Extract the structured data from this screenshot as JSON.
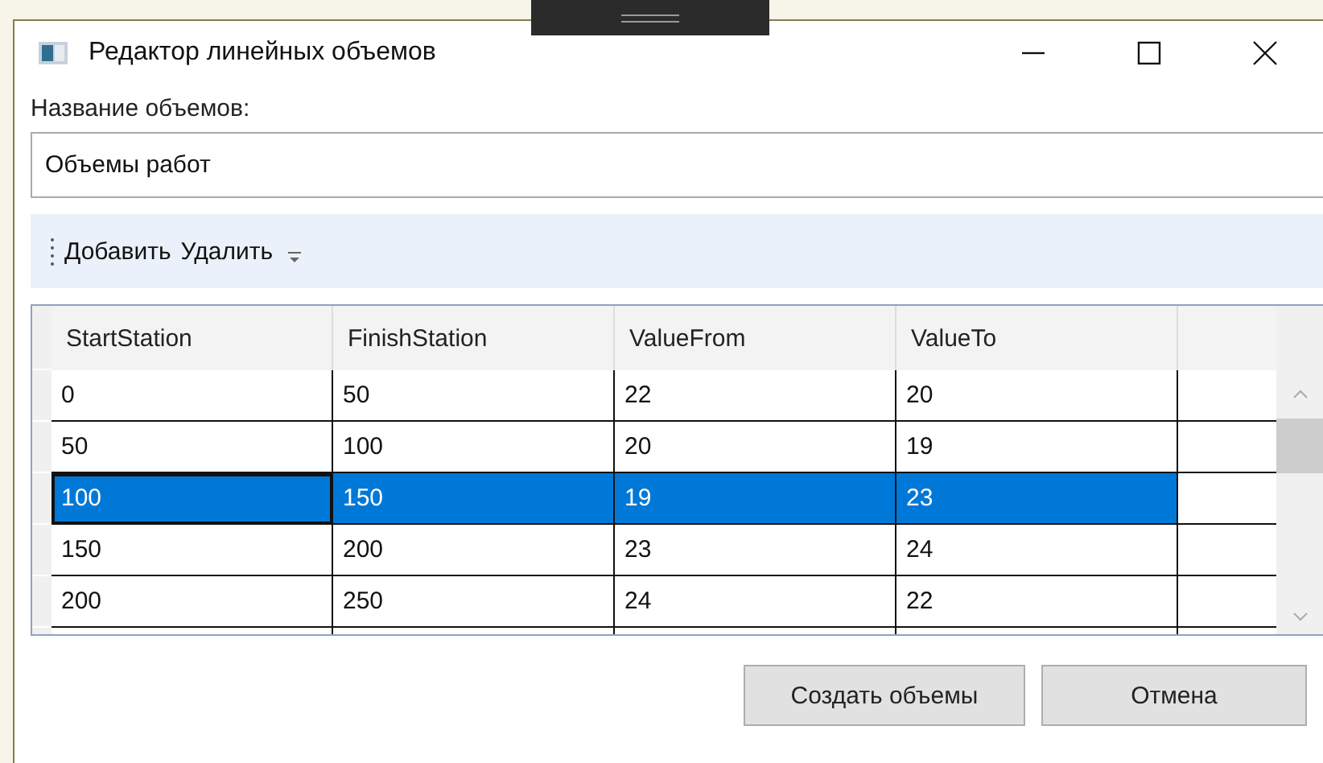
{
  "window": {
    "title": "Редактор линейных объемов"
  },
  "name_field": {
    "label": "Название объемов:",
    "value": "Объемы работ"
  },
  "toolbar": {
    "items": [
      {
        "label": "Добавить"
      },
      {
        "label": "Удалить"
      }
    ]
  },
  "table": {
    "columns": [
      "StartStation",
      "FinishStation",
      "ValueFrom",
      "ValueTo"
    ],
    "rows": [
      {
        "cells": [
          "0",
          "50",
          "22",
          "20"
        ],
        "selected": false
      },
      {
        "cells": [
          "50",
          "100",
          "20",
          "19"
        ],
        "selected": false
      },
      {
        "cells": [
          "100",
          "150",
          "19",
          "23"
        ],
        "selected": true
      },
      {
        "cells": [
          "150",
          "200",
          "23",
          "24"
        ],
        "selected": false
      },
      {
        "cells": [
          "200",
          "250",
          "24",
          "22"
        ],
        "selected": false
      }
    ]
  },
  "buttons": [
    "Создать объемы",
    "Отмена"
  ]
}
